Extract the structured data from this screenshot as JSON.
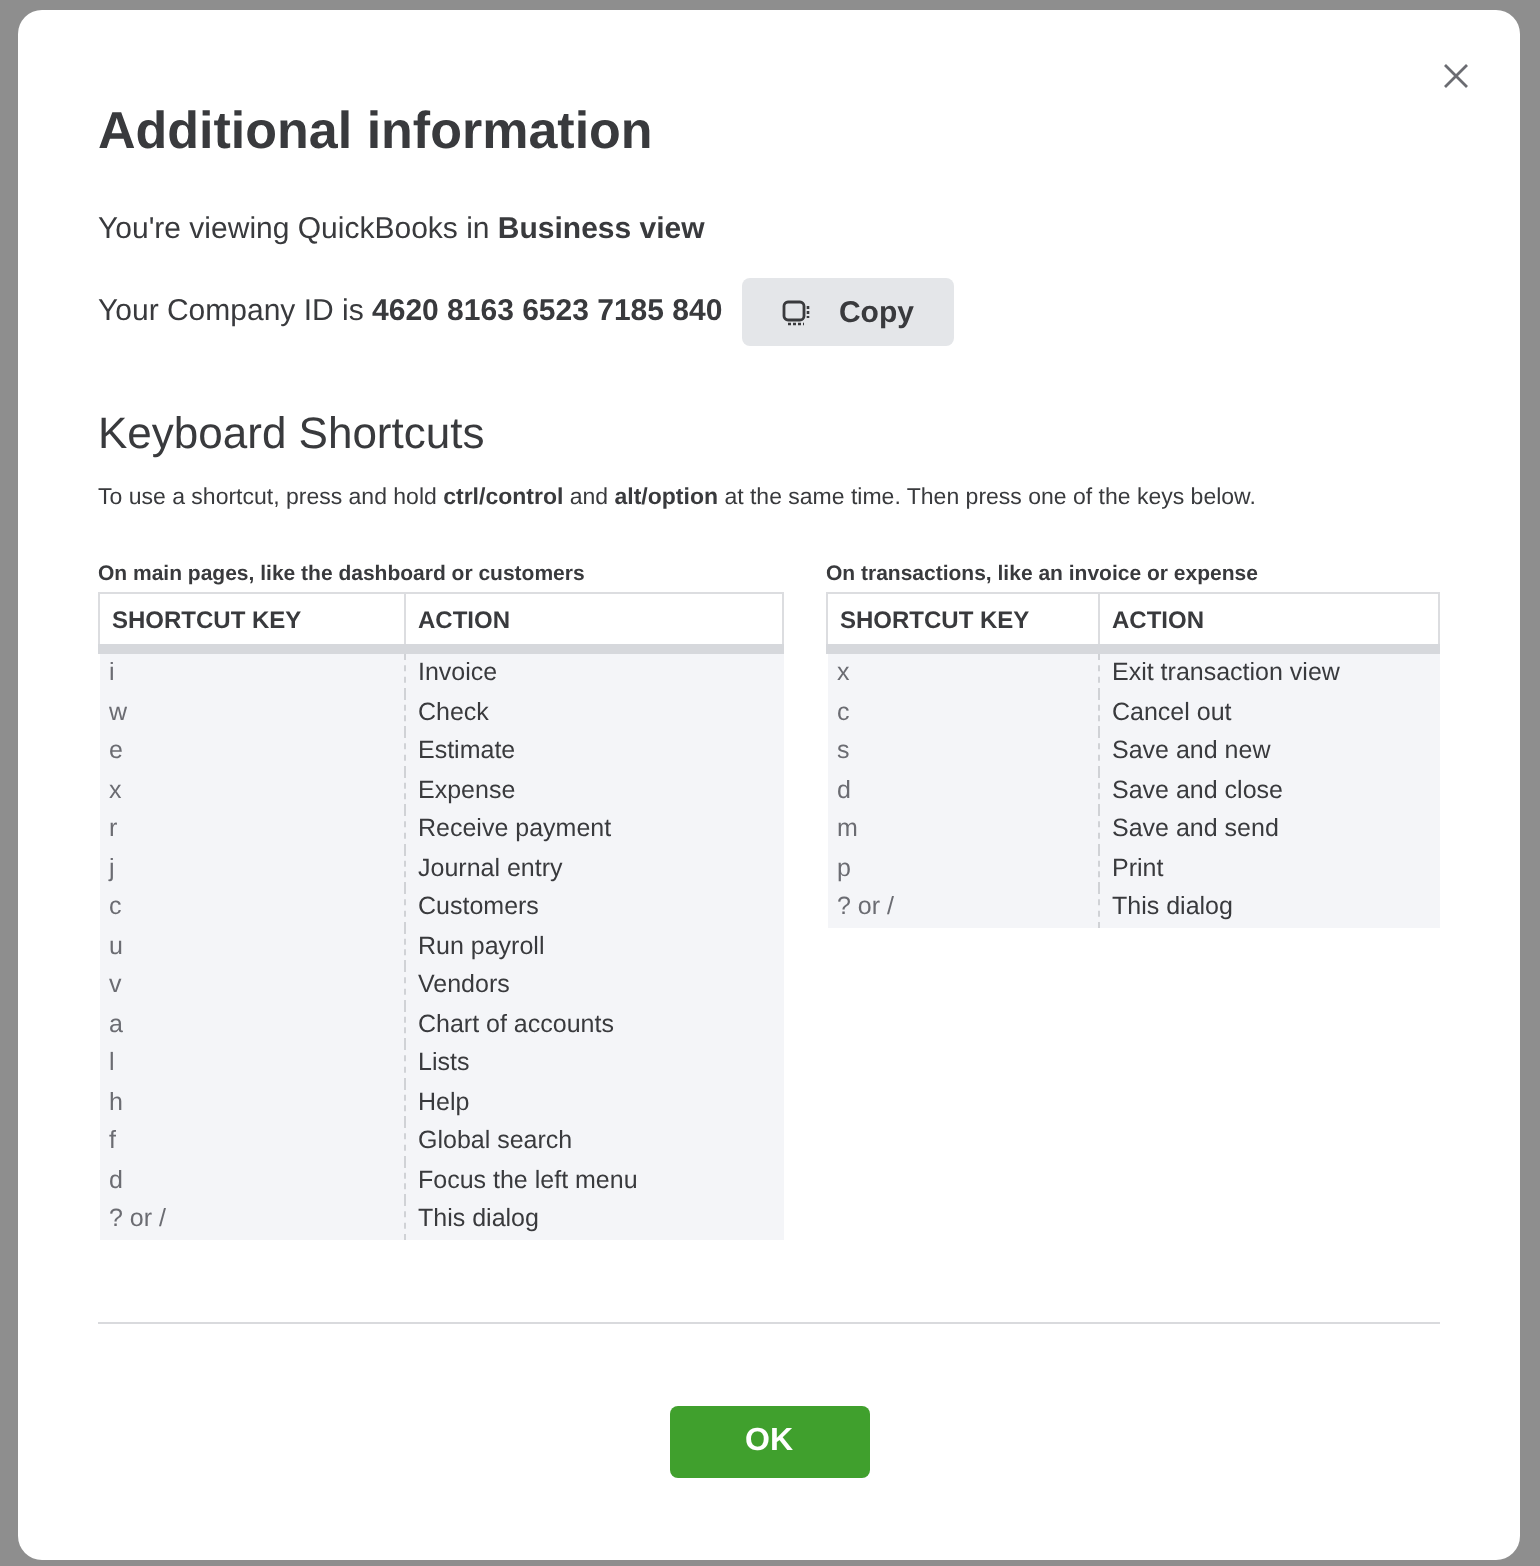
{
  "dialog": {
    "title": "Additional information"
  },
  "view_info": "You're viewing QuickBooks in **Business view**",
  "company_id": {
    "text": "Your Company ID is **4620 8163 6523 7185 840**",
    "copy_button": "Copy"
  },
  "shortcuts": {
    "heading": "Keyboard Shortcuts",
    "instructions": "To use a shortcut, press and hold **ctrl/control** and **alt/option** at the same time. Then press one of the keys below.",
    "tables": [
      {
        "caption": "On main pages, like the dashboard or customers",
        "columns": [
          "SHORTCUT KEY",
          "ACTION"
        ],
        "rows": [
          {
            "key": "i",
            "action": "Invoice"
          },
          {
            "key": "w",
            "action": "Check"
          },
          {
            "key": "e",
            "action": "Estimate"
          },
          {
            "key": "x",
            "action": "Expense"
          },
          {
            "key": "r",
            "action": "Receive payment"
          },
          {
            "key": "j",
            "action": "Journal entry"
          },
          {
            "key": "c",
            "action": "Customers"
          },
          {
            "key": "u",
            "action": "Run payroll"
          },
          {
            "key": "v",
            "action": "Vendors"
          },
          {
            "key": "a",
            "action": "Chart of accounts"
          },
          {
            "key": "l",
            "action": "Lists"
          },
          {
            "key": "h",
            "action": "Help"
          },
          {
            "key": "f",
            "action": "Global search"
          },
          {
            "key": "d",
            "action": "Focus the left menu"
          },
          {
            "key": "? or /",
            "action": "This dialog"
          }
        ]
      },
      {
        "caption": "On transactions, like an invoice or expense",
        "columns": [
          "SHORTCUT KEY",
          "ACTION"
        ],
        "rows": [
          {
            "key": "x",
            "action": "Exit transaction view"
          },
          {
            "key": "c",
            "action": "Cancel out"
          },
          {
            "key": "s",
            "action": "Save and new"
          },
          {
            "key": "d",
            "action": "Save and close"
          },
          {
            "key": "m",
            "action": "Save and send"
          },
          {
            "key": "p",
            "action": "Print"
          },
          {
            "key": "? or /",
            "action": "This dialog"
          }
        ]
      }
    ]
  },
  "buttons": [
    "OK"
  ]
}
